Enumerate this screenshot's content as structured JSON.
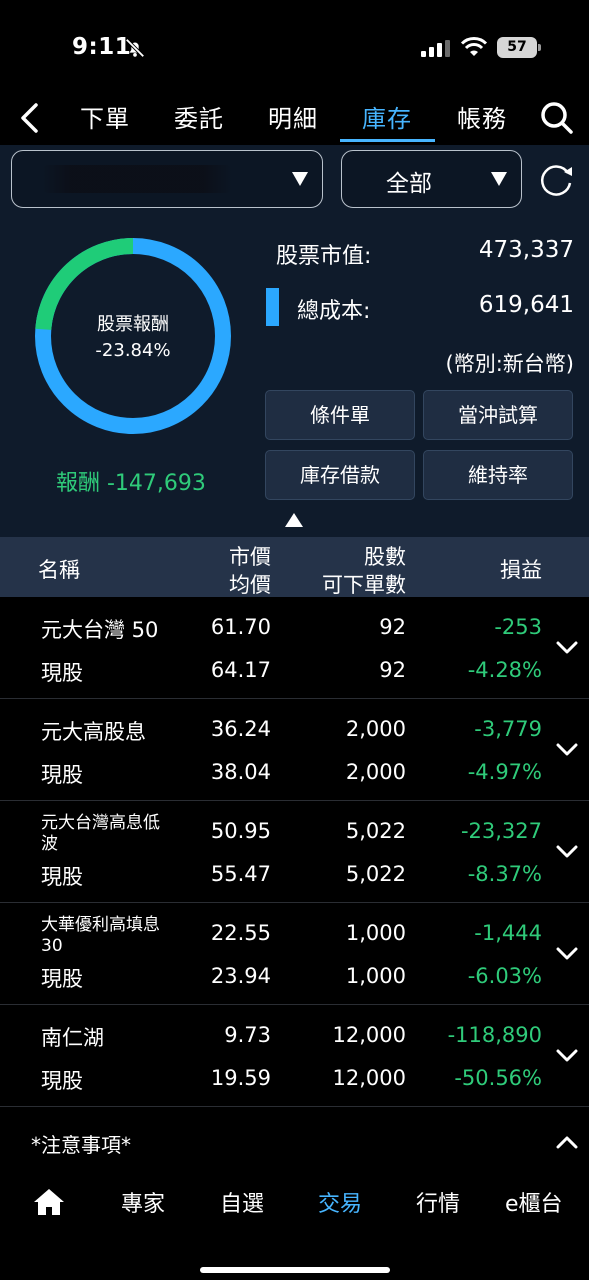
{
  "status_bar": {
    "time": "9:11",
    "battery": "57"
  },
  "tabs": [
    {
      "label": "下單"
    },
    {
      "label": "委託"
    },
    {
      "label": "明細"
    },
    {
      "label": "庫存"
    },
    {
      "label": "帳務"
    }
  ],
  "account_selector": {
    "value": ""
  },
  "filter_selector": {
    "value": "全部"
  },
  "summary": {
    "donut_label": "股票報酬",
    "donut_value": "-23.84%",
    "return_percent": -23.84,
    "reward_text": "報酬 -147,693",
    "market_value_label": "股票市值:",
    "market_value": "473,337",
    "total_cost_label": "總成本:",
    "total_cost": "619,641",
    "currency": "(幣別:新台幣)",
    "colors": {
      "ring": "#2ba8ff",
      "loss_arc": "#1fcc78"
    }
  },
  "actions": [
    {
      "label": "條件單"
    },
    {
      "label": "當沖試算"
    },
    {
      "label": "庫存借款"
    },
    {
      "label": "維持率"
    }
  ],
  "table": {
    "headers": {
      "name": "名稱",
      "price": "市價",
      "avg": "均價",
      "shares": "股數",
      "avail": "可下單數",
      "pl": "損益"
    },
    "rows": [
      {
        "name": "元大台灣 50",
        "type": "現股",
        "price": "61.70",
        "avg": "64.17",
        "shares": "92",
        "avail": "92",
        "pl": "-253",
        "pct": "-4.28%"
      },
      {
        "name": "元大高股息",
        "type": "現股",
        "price": "36.24",
        "avg": "38.04",
        "shares": "2,000",
        "avail": "2,000",
        "pl": "-3,779",
        "pct": "-4.97%"
      },
      {
        "name": "元大台灣高息低波",
        "type": "現股",
        "price": "50.95",
        "avg": "55.47",
        "shares": "5,022",
        "avail": "5,022",
        "pl": "-23,327",
        "pct": "-8.37%"
      },
      {
        "name": "大華優利高填息30",
        "type": "現股",
        "price": "22.55",
        "avg": "23.94",
        "shares": "1,000",
        "avail": "1,000",
        "pl": "-1,444",
        "pct": "-6.03%"
      },
      {
        "name": "南仁湖",
        "type": "現股",
        "price": "9.73",
        "avg": "19.59",
        "shares": "12,000",
        "avail": "12,000",
        "pl": "-118,890",
        "pct": "-50.56%"
      }
    ]
  },
  "notice": {
    "label": "*注意事項*"
  },
  "bottom_nav": [
    {
      "label": "專家"
    },
    {
      "label": "自選"
    },
    {
      "label": "交易"
    },
    {
      "label": "行情"
    },
    {
      "label": "e櫃台"
    }
  ],
  "colors": {
    "accent": "#47b5ff",
    "loss": "#2fcb7a",
    "panel": "#0f1b2b",
    "header": "#253349"
  }
}
